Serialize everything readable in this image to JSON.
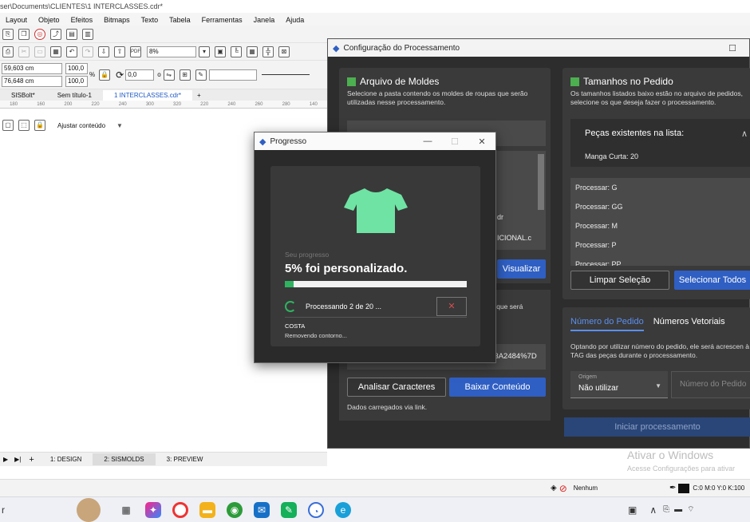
{
  "app": {
    "title": "ser\\Documents\\CLIENTES\\1 INTERCLASSES.cdr*",
    "menu": [
      "Layout",
      "Objeto",
      "Efeitos",
      "Bitmaps",
      "Texto",
      "Tabela",
      "Ferramentas",
      "Janela",
      "Ajuda"
    ],
    "zoom": "8%",
    "x_value": "59,603 cm",
    "y_value": "76,648 cm",
    "scale_w": "100,0",
    "scale_h": "100,0",
    "percent": "%",
    "rotation": "0,0",
    "rotation_unit": "o",
    "doc_tabs": [
      "SISBolt*",
      "Sem título-1",
      "1 INTERCLASSES.cdr*"
    ],
    "ruler_ticks": [
      "180",
      "160",
      "200",
      "220",
      "240",
      "300",
      "320",
      "220",
      "240",
      "260",
      "280",
      "140"
    ],
    "fit_content": "Ajustar conteúdo",
    "page_tabs": [
      "1: DESIGN",
      "2: SISMOLDS",
      "3: PREVIEW"
    ],
    "fill_status": "Nenhum",
    "color_status": "C:0 M:0 Y:0 K:100",
    "search_fragment": "r"
  },
  "config": {
    "window_title": "Configuração do Processamento",
    "molds": {
      "title": "Arquivo de Moldes",
      "desc": "Selecione a pasta contendo os moldes de roupas que serão utilizadas nesse processamento.",
      "file_fragment_1": "dr",
      "file_fragment_2": "ICIONAL.c",
      "view_button": "Visualizar"
    },
    "link": {
      "desc_fragment": "ist, que será",
      "url_value": "44847918340&cig=%7B%22CAMI%22%3A2484%7D",
      "analyze_button": "Analisar Caracteres",
      "download_button": "Baixar Conteúdo",
      "status": "Dados carregados via link."
    },
    "sizes": {
      "title": "Tamanhos no Pedido",
      "desc": "Os tamanhos listados baixo estão no arquivo de pedidos, selecione os que deseja fazer o processamento.",
      "pieces_header": "Peças existentes na lista:",
      "pieces_item": "Manga Curta: 20",
      "list": [
        "Processar: G",
        "Processar: GG",
        "Processar: M",
        "Processar: P",
        "Processar: PP"
      ],
      "clear_button": "Limpar Seleção",
      "select_all_button": "Selecionar Todos"
    },
    "order": {
      "tab_order": "Número do Pedido",
      "tab_vector": "Números Vetoriais",
      "desc": "Optando por utilizar número do pedido, ele será acrescen à TAG das peças durante o processamento.",
      "origin_label": "Origem",
      "origin_value": "Não utilizar",
      "order_placeholder": "Número do Pedido",
      "start_button": "Iniciar processamento"
    }
  },
  "progress": {
    "window_title": "Progresso",
    "label": "Seu progresso",
    "headline": "5% foi personalizado.",
    "fraction": 0.05,
    "status": "Processando 2 de 20 ...",
    "cancel_glyph": "✕",
    "item_name": "COSTA",
    "item_action": "Removendo contorno...",
    "shirt_color": "#6fe3a4"
  },
  "watermark": {
    "line1": "Ativar o Windows",
    "line2": "Acesse Configurações para ativar"
  }
}
